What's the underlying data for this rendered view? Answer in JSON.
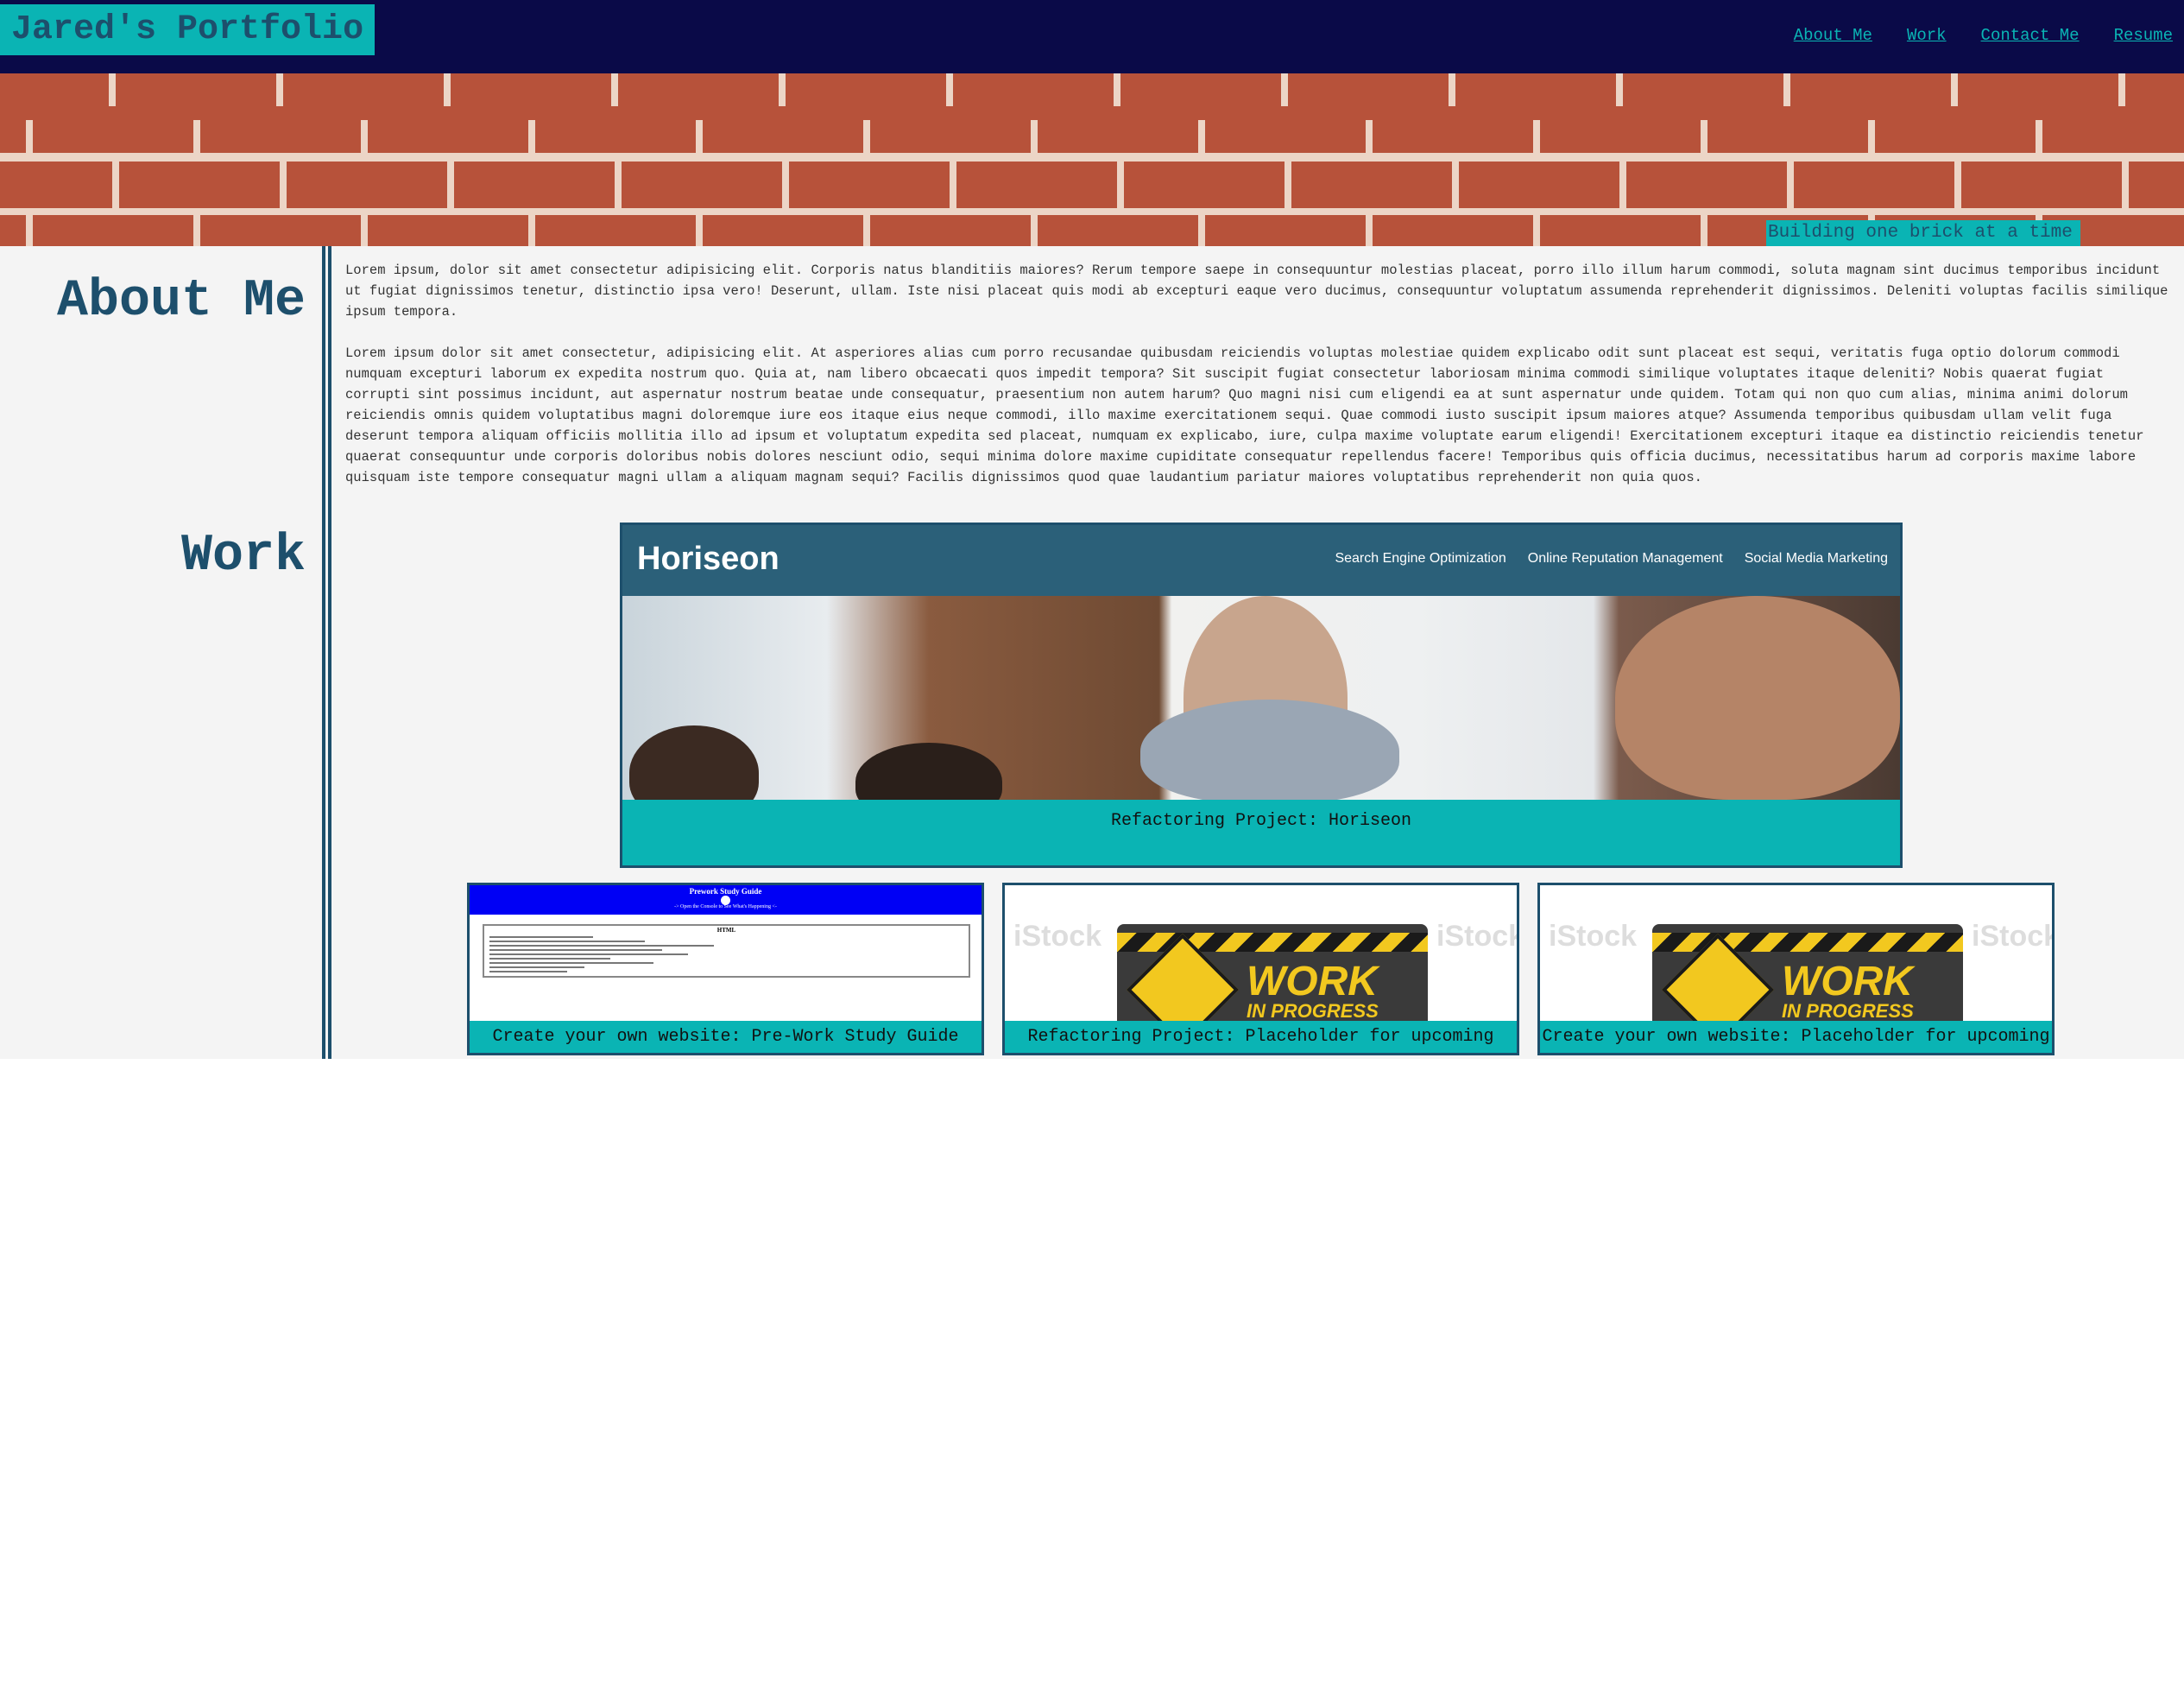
{
  "header": {
    "brand": "Jared's Portfolio",
    "nav": [
      "About Me",
      "Work",
      "Contact Me",
      "Resume"
    ]
  },
  "hero": {
    "tagline": "Building one brick at a time"
  },
  "about": {
    "title": "About Me",
    "paragraphs": [
      "Lorem ipsum, dolor sit amet consectetur adipisicing elit. Corporis natus blanditiis maiores? Rerum tempore saepe in consequuntur molestias placeat, porro illo illum harum commodi, soluta magnam sint ducimus temporibus incidunt ut fugiat dignissimos tenetur, distinctio ipsa vero! Deserunt, ullam. Iste nisi placeat quis modi ab excepturi eaque vero ducimus, consequuntur voluptatum assumenda reprehenderit dignissimos. Deleniti voluptas facilis similique ipsum tempora.",
      "Lorem ipsum dolor sit amet consectetur, adipisicing elit. At asperiores alias cum porro recusandae quibusdam reiciendis voluptas molestiae quidem explicabo odit sunt placeat est sequi, veritatis fuga optio dolorum commodi numquam excepturi laborum ex expedita nostrum quo. Quia at, nam libero obcaecati quos impedit tempora? Sit suscipit fugiat consectetur laboriosam minima commodi similique voluptates itaque deleniti? Nobis quaerat fugiat corrupti sint possimus incidunt, aut aspernatur nostrum beatae unde consequatur, praesentium non autem harum? Quo magni nisi cum eligendi ea at sunt aspernatur unde quidem. Totam qui non quo cum alias, minima animi dolorum reiciendis omnis quidem voluptatibus magni doloremque iure eos itaque eius neque commodi, illo maxime exercitationem sequi. Quae commodi iusto suscipit ipsum maiores atque? Assumenda temporibus quibusdam ullam velit fuga deserunt tempora aliquam officiis mollitia illo ad ipsum et voluptatum expedita sed placeat, numquam ex explicabo, iure, culpa maxime voluptate earum eligendi! Exercitationem excepturi itaque ea distinctio reiciendis tenetur quaerat consequuntur unde corporis doloribus nobis dolores nesciunt odio, sequi minima dolore maxime cupiditate consequatur repellendus facere! Temporibus quis officia ducimus, necessitatibus harum ad corporis maxime labore quisquam iste tempore consequatur magni ullam a aliquam magnam sequi? Facilis dignissimos quod quae laudantium pariatur maiores voluptatibus reprehenderit non quia quos."
    ]
  },
  "work": {
    "title": "Work",
    "featured": {
      "caption": "Refactoring Project: Horiseon",
      "screenshot": {
        "logo": "Horiseon",
        "nav": [
          "Search Engine Optimization",
          "Online Reputation Management",
          "Social Media Marketing"
        ]
      }
    },
    "cards": [
      {
        "caption": "Create your own website: Pre-Work Study Guide",
        "screenshot": {
          "title": "Prework Study Guide",
          "subtitle": "-> Open the Console to See What's Happening <-",
          "section": "HTML"
        }
      },
      {
        "caption": "Refactoring Project: Placeholder for upcoming",
        "screenshot": {
          "sign": "WORK",
          "sign_sub": "IN PROGRESS",
          "watermark": "iStock"
        }
      },
      {
        "caption": "Create your own website: Placeholder for upcoming",
        "screenshot": {
          "sign": "WORK",
          "sign_sub": "IN PROGRESS",
          "watermark": "iStock"
        }
      }
    ]
  },
  "colors": {
    "header_bg": "#0a0a48",
    "accent": "#0ab4b4",
    "title": "#1d4f6c",
    "brick": "#b7523a",
    "mortar": "#ecd5c6",
    "main_bg": "#f4f4f4"
  }
}
